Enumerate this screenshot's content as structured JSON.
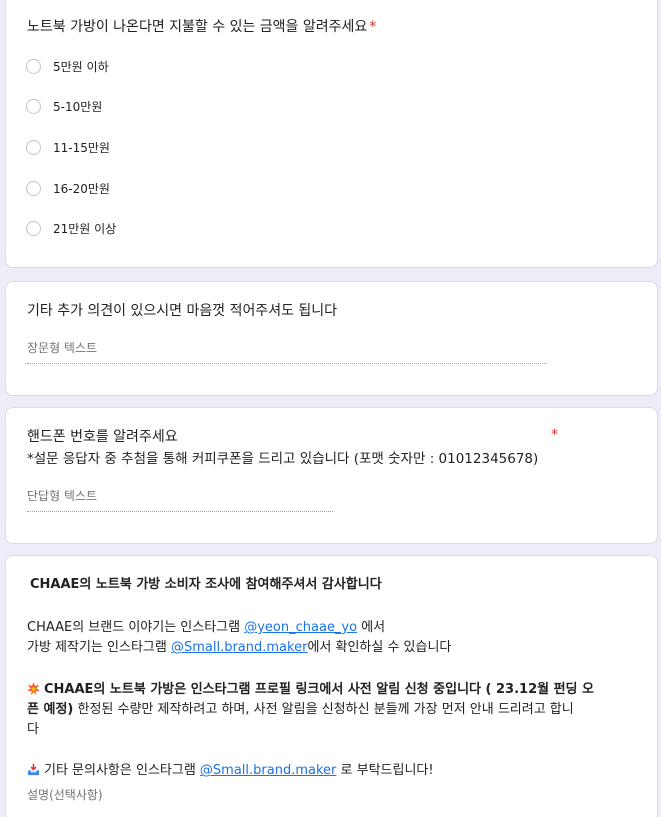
{
  "q_budget": {
    "title": "노트북 가방이 나온다면 지불할 수 있는 금액을 알려주세요",
    "required_mark": "*",
    "options": [
      "5만원 이하",
      "5-10만원",
      "11-15만원",
      "16-20만원",
      "21만원 이상"
    ]
  },
  "q_comment": {
    "title": "기타 추가 의견이 있으시면 마음껏 적어주셔도 됩니다",
    "placeholder": "장문형 텍스트"
  },
  "q_phone": {
    "title_line1": "핸드폰 번호를 알려주세요",
    "title_line2": "*설문 응답자 중 추첨을 통해 커피쿠폰을 드리고 있습니다 (포맷 숫자만 : 01012345678)",
    "required_mark": "*",
    "placeholder": "단답형 텍스트"
  },
  "thanks": {
    "heading": "CHAAE의 노트북 가방 소비자 조사에 참여해주셔서 감사합니다",
    "line1_prefix": "CHAAE의 브랜드 이야기는 인스타그램 ",
    "line1_link": "@yeon_chaae_yo",
    "line1_suffix": " 에서",
    "line2_prefix": "가방 제작기는 인스타그램 ",
    "line2_link": "@Small.brand.maker",
    "line2_suffix": "에서 확인하실 수 있습니다",
    "notice_line1_bold": "CHAAE의 노트북 가방은 인스타그램 프로필 링크에서 사전 알림 신청 중입니다 ( 23.12월 펀딩 오",
    "notice_line2_bold": "픈 예정)",
    "notice_line2_rest": " 한정된 수량만 제작하려고 하며, 사전 알림을 신청하신 분들께 가장 먼저 안내 드리려고 합니",
    "notice_line3": "다",
    "contact_prefix": "기타 문의사항은 인스타그램  ",
    "contact_link": "@Small.brand.maker",
    "contact_suffix": " 로 부탁드립니다!",
    "description_label": "설명(선택사항)"
  },
  "colors": {
    "background": "#f0ebf8",
    "required": "#d93025",
    "link": "#1a73e8"
  }
}
